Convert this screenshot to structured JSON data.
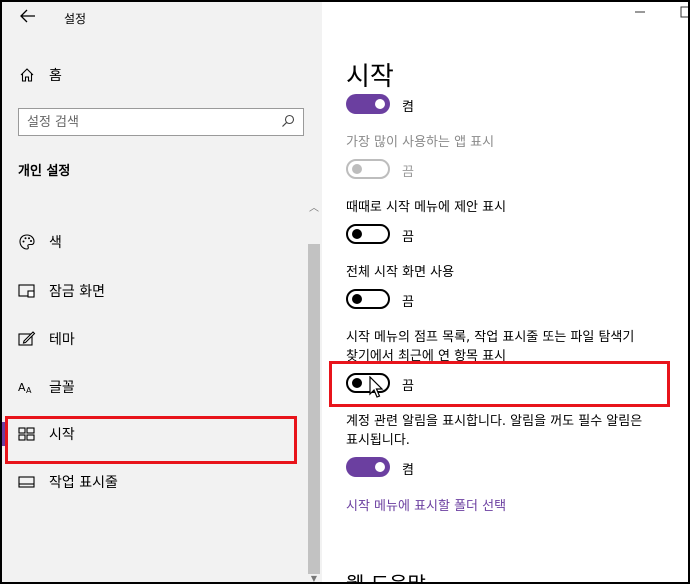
{
  "window": {
    "title": "설정",
    "back_label": "←",
    "minimize": "—",
    "maximize": "☐"
  },
  "sidebar": {
    "home_label": "홈",
    "search_placeholder": "설정 검색",
    "section_title": "개인 설정",
    "items": [
      {
        "label": "색",
        "icon": "palette-icon"
      },
      {
        "label": "잠금 화면",
        "icon": "lock-screen-icon"
      },
      {
        "label": "테마",
        "icon": "theme-icon"
      },
      {
        "label": "글꼴",
        "icon": "font-icon"
      },
      {
        "label": "시작",
        "icon": "start-icon",
        "active": true
      },
      {
        "label": "작업 표시줄",
        "icon": "taskbar-icon"
      }
    ]
  },
  "main": {
    "title": "시작",
    "settings": [
      {
        "label": "",
        "state": "켬",
        "on": true,
        "disabled": false
      },
      {
        "label": "가장 많이 사용하는 앱 표시",
        "state": "끔",
        "on": false,
        "disabled": true
      },
      {
        "label": "때때로 시작 메뉴에 제안 표시",
        "state": "끔",
        "on": false,
        "disabled": false
      },
      {
        "label": "전체 시작 화면 사용",
        "state": "끔",
        "on": false,
        "disabled": false
      },
      {
        "label_line1": "시작 메뉴의 점프 목록, 작업 표시줄 또는 파일 탐색기",
        "label_line2": "찾기에서 최근에 연 항목 표시",
        "state": "끔",
        "on": false,
        "disabled": false
      },
      {
        "label_line1": "계정 관련 알림을 표시합니다. 알림을 꺼도 필수 알림은",
        "label_line2": "표시됩니다.",
        "state": "켬",
        "on": true,
        "disabled": false
      }
    ],
    "link": "시작 메뉴에 표시할 폴더 선택",
    "help_heading": "웹 도움말"
  },
  "colors": {
    "accent": "#6b3fa0",
    "highlight": "#e8141b",
    "sidebar_bg": "#f2f2f2"
  }
}
